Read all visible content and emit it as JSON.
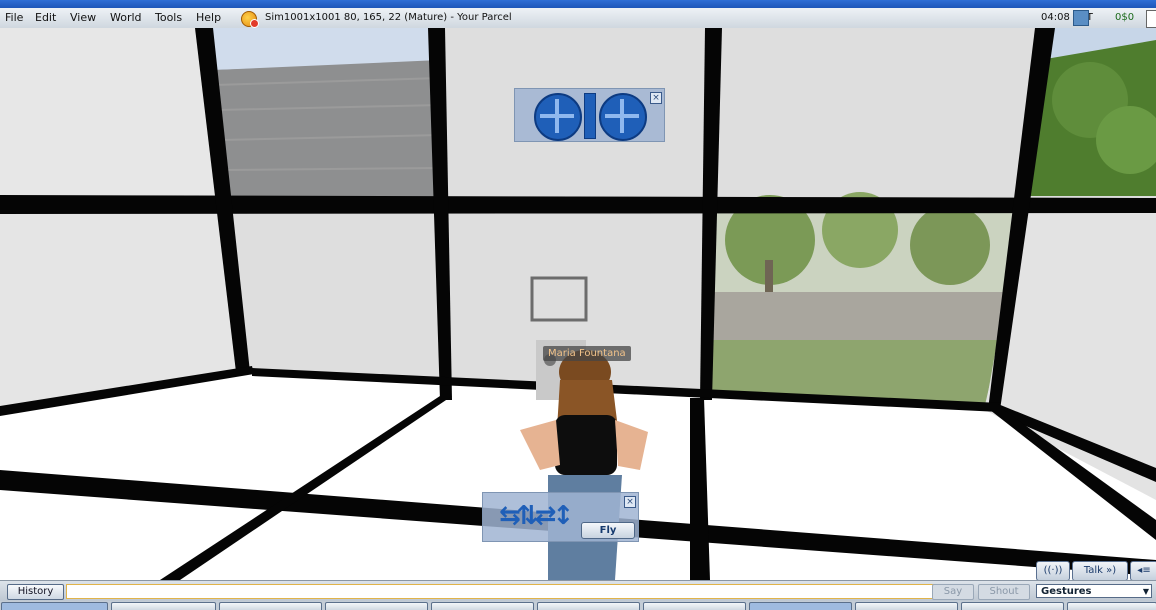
{
  "menu": {
    "items": [
      "File",
      "Edit",
      "View",
      "World",
      "Tools",
      "Help"
    ],
    "location": "Sim1001x1001 80, 165, 22 (Mature) - Your Parcel",
    "time": "04:08 PDT",
    "balance": "0$0"
  },
  "scene": {
    "avatar_name": "Maria Fountana"
  },
  "movement": {
    "fly_label": "Fly"
  },
  "voice": {
    "talk_label": "Talk"
  },
  "chat": {
    "history_label": "History",
    "input_value": "",
    "say_label": "Say",
    "shout_label": "Shout",
    "gestures_label": "Gestures"
  },
  "colors": {
    "accent": "#1f5fb8",
    "balance_green": "#1b6a1b",
    "nametag": "#f2c38a"
  }
}
